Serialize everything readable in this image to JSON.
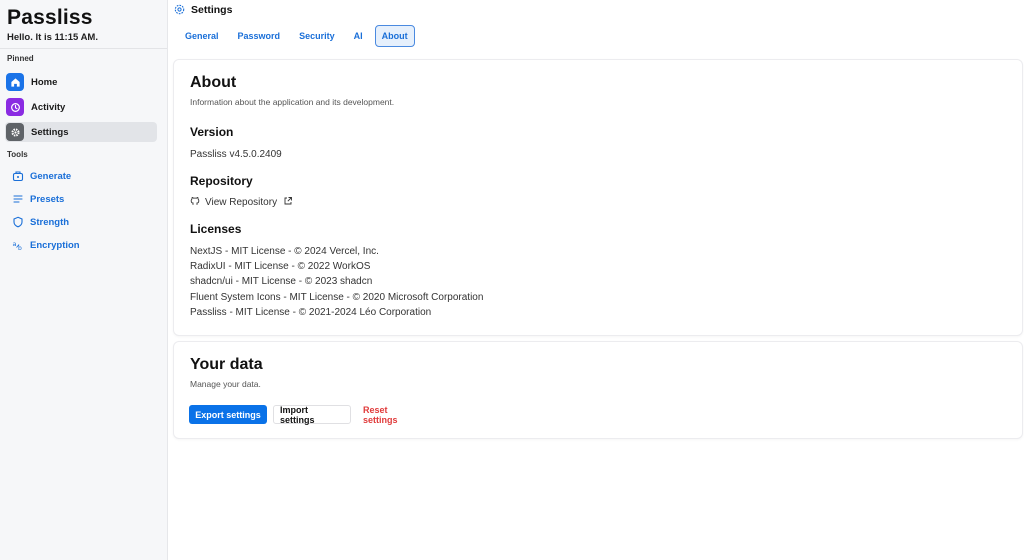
{
  "app": {
    "name": "Passliss",
    "greeting": "Hello. It is 11:15 AM."
  },
  "sidebar": {
    "pinned_label": "Pinned",
    "pinned": [
      {
        "label": "Home",
        "icon": "home-icon",
        "color": "#1a73e8"
      },
      {
        "label": "Activity",
        "icon": "history-icon",
        "color": "#8a2be2"
      },
      {
        "label": "Settings",
        "icon": "gear-icon",
        "color": "#5f6368"
      }
    ],
    "tools_label": "Tools",
    "tools": [
      {
        "label": "Generate",
        "icon": "generate-icon"
      },
      {
        "label": "Presets",
        "icon": "list-icon"
      },
      {
        "label": "Strength",
        "icon": "shield-icon"
      },
      {
        "label": "Encryption",
        "icon": "translate-icon"
      }
    ]
  },
  "header": {
    "title": "Settings",
    "icon": "gear-icon"
  },
  "tabs": [
    {
      "label": "General"
    },
    {
      "label": "Password"
    },
    {
      "label": "Security"
    },
    {
      "label": "AI"
    },
    {
      "label": "About",
      "active": true
    }
  ],
  "about": {
    "title": "About",
    "subtitle": "Information about the application and its development.",
    "version_heading": "Version",
    "version_value": "Passliss v4.5.0.2409",
    "repository_heading": "Repository",
    "repository_link": "View Repository",
    "licenses_heading": "Licenses",
    "licenses": [
      "NextJS - MIT License - © 2024 Vercel, Inc.",
      "RadixUI - MIT License - © 2022 WorkOS",
      "shadcn/ui - MIT License - © 2023 shadcn",
      "Fluent System Icons - MIT License - © 2020 Microsoft Corporation",
      "Passliss - MIT License - © 2021-2024 Léo Corporation"
    ]
  },
  "your_data": {
    "title": "Your data",
    "subtitle": "Manage your data.",
    "export_label": "Export settings",
    "import_label": "Import settings",
    "reset_label": "Reset settings"
  },
  "colors": {
    "accent": "#0a72e8",
    "danger": "#e03a3a",
    "sidebar_bg": "#f6f7f9"
  }
}
